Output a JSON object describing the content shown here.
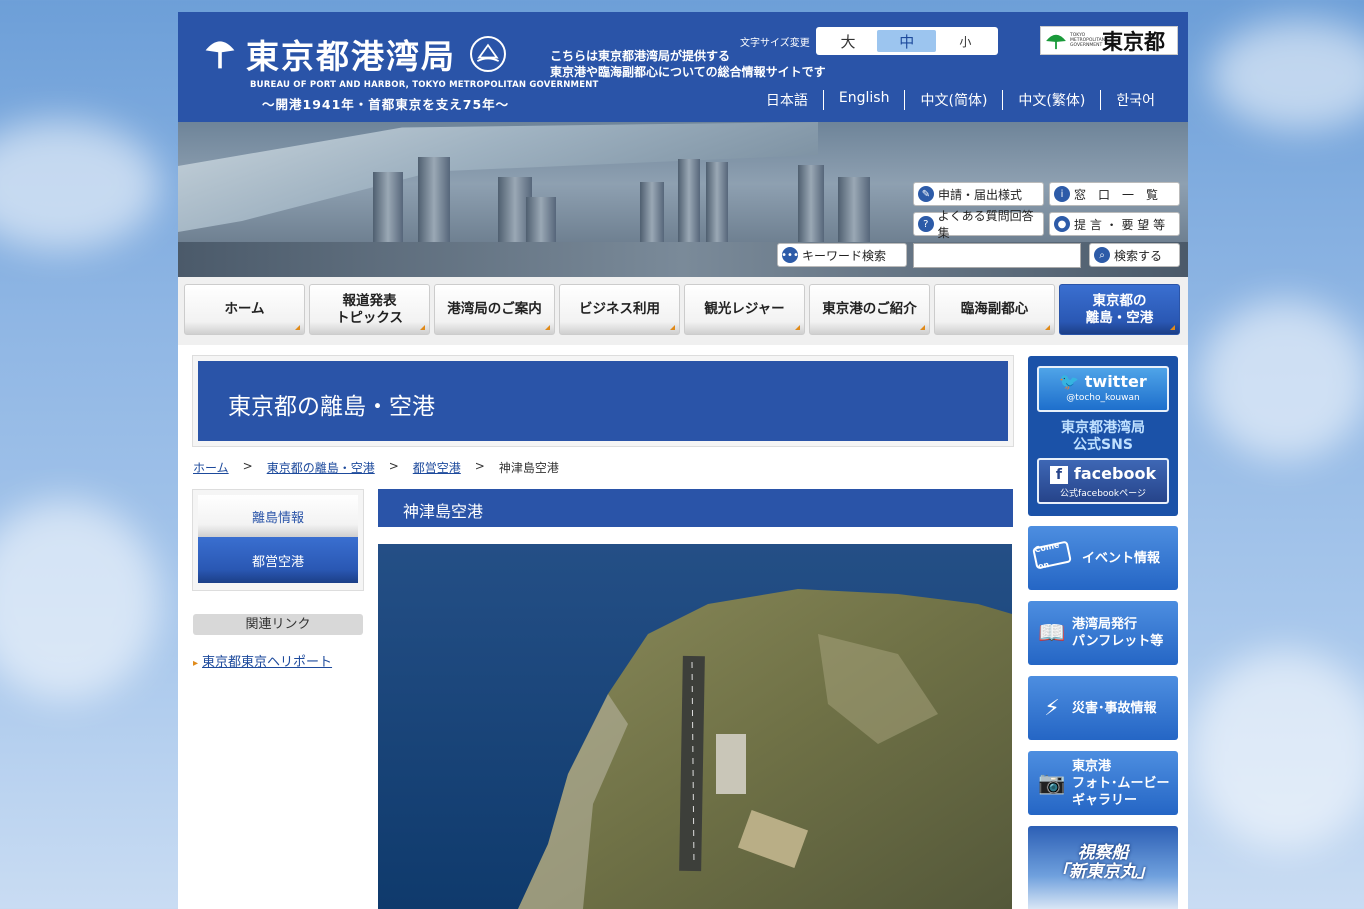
{
  "header": {
    "logo_title": "東京都港湾局",
    "logo_en": "BUREAU OF PORT AND HARBOR, TOKYO METROPOLITAN GOVERNMENT",
    "logo_sub": "〜開港1941年・首都東京を支え75年〜",
    "desc_line1": "こちらは東京都港湾局が提供する",
    "desc_line2": "東京港や臨海副都心についての総合情報サイトです",
    "fontsize_label": "文字サイズ変更",
    "fontsize": [
      "大",
      "中",
      "小"
    ],
    "metro_logo_en": "TOKYO METROPOLITAN GOVERNMENT",
    "metro_logo_jp": "東京都",
    "languages": [
      "日本語",
      "English",
      "中文(简体)",
      "中文(繁体)",
      "한국어"
    ]
  },
  "hero": {
    "btn_forms": "申請・届出様式",
    "btn_windows": "窓　口　一　覧",
    "btn_faq": "よくある質問回答集",
    "btn_proposal": "提 言 ・ 要 望 等",
    "keyword_label": "キーワード検索",
    "search_button": "検索する"
  },
  "nav": {
    "items": [
      {
        "label": "ホーム"
      },
      {
        "label": "報道発表\nトピックス"
      },
      {
        "label": "港湾局のご案内"
      },
      {
        "label": "ビジネス利用"
      },
      {
        "label": "観光レジャー"
      },
      {
        "label": "東京港のご紹介"
      },
      {
        "label": "臨海副都心"
      },
      {
        "label": "東京都の\n離島・空港"
      }
    ]
  },
  "main": {
    "banner_title": "東京都の離島・空港",
    "breadcrumb": [
      "ホーム",
      "東京都の離島・空港",
      "都営空港",
      "神津島空港"
    ],
    "breadcrumb_sep": ">",
    "section_title": "神津島空港"
  },
  "sidenav": {
    "item1": "離島情報",
    "item2": "都営空港",
    "related_heading": "関連リンク",
    "related_link": "東京都東京ヘリポート"
  },
  "right": {
    "twitter": "twitter",
    "twitter_handle": "@tocho_kouwan",
    "sns_line1": "東京都港湾局",
    "sns_line2": "公式SNS",
    "facebook": "facebook",
    "facebook_sub": "公式facebookページ",
    "event_badge": "Come on",
    "event": "イベント情報",
    "pamphlet_line1": "港湾局発行",
    "pamphlet_line2": "パンフレット等",
    "disaster": "災害･事故情報",
    "photo_line1": "東京港",
    "photo_line2": "フォト･ムービー",
    "photo_line3": "ギャラリー",
    "ship_line1": "視察船",
    "ship_line2": "「新東京丸」"
  }
}
